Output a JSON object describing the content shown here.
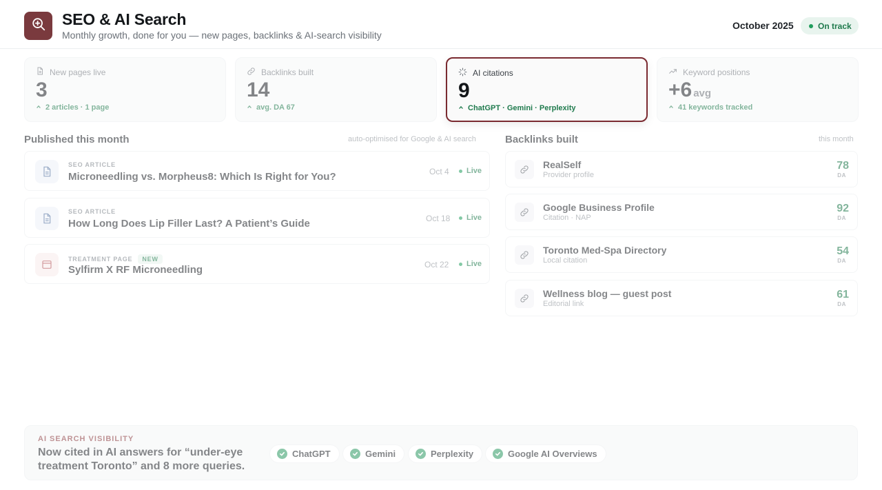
{
  "header": {
    "title": "SEO & AI Search",
    "subtitle": "Monthly growth, done for you — new pages, backlinks & AI-search visibility",
    "period": "October 2025",
    "status": "On track"
  },
  "stats": [
    {
      "label": "New pages live",
      "value": "3",
      "unit": "",
      "note": "2 articles · 1 page",
      "icon": "document-icon"
    },
    {
      "label": "Backlinks built",
      "value": "14",
      "unit": "",
      "note": "avg. DA 67",
      "icon": "link-icon"
    },
    {
      "label": "AI citations",
      "value": "9",
      "unit": "",
      "note": "ChatGPT · Gemini · Perplexity",
      "icon": "sparkle-icon"
    },
    {
      "label": "Keyword positions",
      "value": "+6",
      "unit": "avg",
      "note": "41 keywords tracked",
      "icon": "trend-up-icon"
    }
  ],
  "published": {
    "title": "Published this month",
    "hint": "auto-optimised for Google & AI search",
    "items": [
      {
        "kind": "SEO ARTICLE",
        "title": "Microneedling vs. Morpheus8: Which Is Right for You?",
        "date": "Oct 4",
        "status": "Live",
        "badge": ""
      },
      {
        "kind": "SEO ARTICLE",
        "title": "How Long Does Lip Filler Last? A Patient’s Guide",
        "date": "Oct 18",
        "status": "Live",
        "badge": ""
      },
      {
        "kind": "TREATMENT PAGE",
        "title": "Sylfirm X RF Microneedling",
        "date": "Oct 22",
        "status": "Live",
        "badge": "NEW"
      }
    ]
  },
  "backlinks": {
    "title": "Backlinks built",
    "hint": "this month",
    "items": [
      {
        "name": "RealSelf",
        "desc": "Provider profile",
        "da": "78",
        "da_label": "DA"
      },
      {
        "name": "Google Business Profile",
        "desc": "Citation · NAP",
        "da": "92",
        "da_label": "DA"
      },
      {
        "name": "Toronto Med-Spa Directory",
        "desc": "Local citation",
        "da": "54",
        "da_label": "DA"
      },
      {
        "name": "Wellness blog — guest post",
        "desc": "Editorial link",
        "da": "61",
        "da_label": "DA"
      }
    ]
  },
  "banner": {
    "kicker": "AI SEARCH VISIBILITY",
    "text": "Now cited in AI answers for “under-eye treatment Toronto” and 8 more queries.",
    "engines": [
      "ChatGPT",
      "Gemini",
      "Perplexity",
      "Google AI Overviews"
    ]
  },
  "colors": {
    "brand": "#7a3a3e",
    "success": "#1f7a4d",
    "active_border": "#7a2a30"
  }
}
